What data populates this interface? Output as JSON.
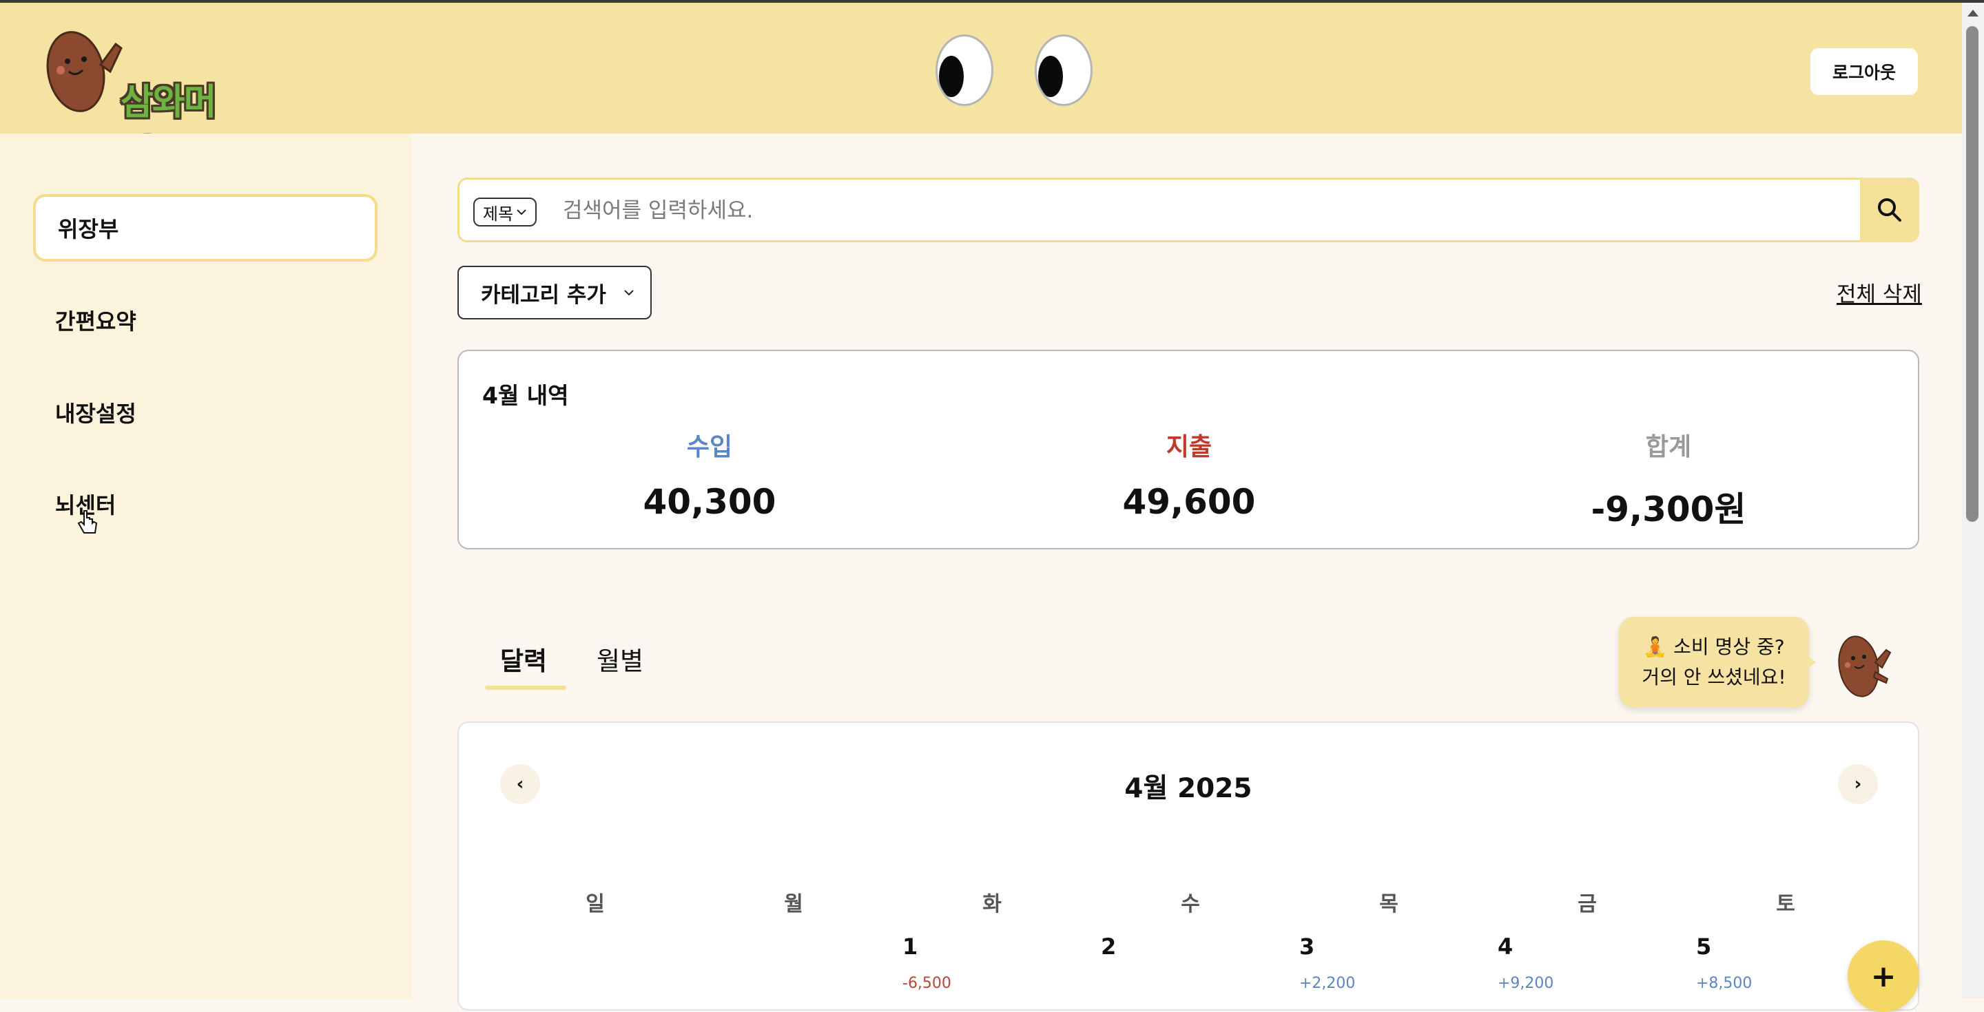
{
  "header": {
    "logo_text": "삼와머니",
    "logout_label": "로그아웃"
  },
  "sidebar": {
    "items": [
      {
        "label": "위장부",
        "active": true
      },
      {
        "label": "간편요약"
      },
      {
        "label": "내장설정"
      },
      {
        "label": "뇌센터"
      }
    ]
  },
  "search": {
    "field_option": "제목",
    "placeholder": "검색어를 입력하세요."
  },
  "toolbar": {
    "category_label": "카테고리 추가",
    "delete_all_label": "전체 삭제"
  },
  "summary": {
    "title": "4월 내역",
    "income_label": "수입",
    "income_value": "40,300",
    "expense_label": "지출",
    "expense_value": "49,600",
    "total_label": "합계",
    "total_value": "-9,300원",
    "colors": {
      "income": "#5b86c5",
      "expense": "#c0392b",
      "total": "#9a9a9a"
    }
  },
  "tabs": [
    {
      "label": "달력",
      "active": true
    },
    {
      "label": "월별"
    }
  ],
  "bubble": {
    "line1": "🧘 소비 명상 중?",
    "line2": "거의 안 쓰셨네요!"
  },
  "calendar": {
    "title": "4월 2025",
    "prev_label": "‹",
    "next_label": "›",
    "weekdays": [
      "일",
      "월",
      "화",
      "수",
      "목",
      "금",
      "토"
    ],
    "days": [
      {
        "num": "1",
        "amount": "-6,500",
        "type": "neg"
      },
      {
        "num": "2",
        "amount": "",
        "type": ""
      },
      {
        "num": "3",
        "amount": "+2,200",
        "type": "pos"
      },
      {
        "num": "4",
        "amount": "+9,200",
        "type": "pos"
      },
      {
        "num": "5",
        "amount": "+8,500",
        "type": "pos"
      }
    ]
  },
  "fab_label": "+"
}
